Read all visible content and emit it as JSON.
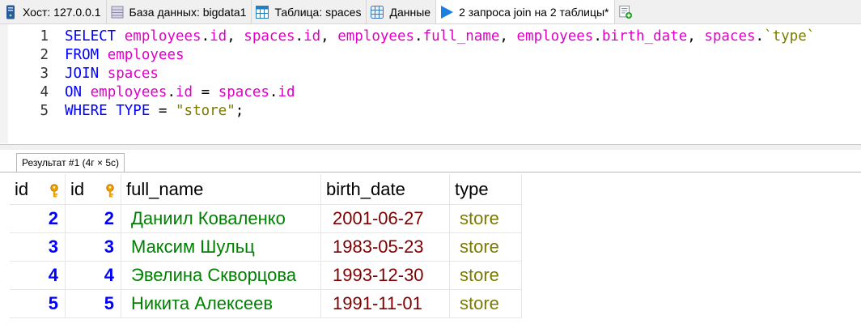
{
  "tabs": [
    {
      "label": "Хост: 127.0.0.1",
      "icon": "server-icon"
    },
    {
      "label": "База данных: bigdata1",
      "icon": "database-icon"
    },
    {
      "label": "Таблица: spaces",
      "icon": "table-icon"
    },
    {
      "label": "Данные",
      "icon": "grid-icon"
    },
    {
      "label": "2 запроса join на 2 таблицы*",
      "icon": "play-icon"
    },
    {
      "label": "",
      "icon": "new-query-icon"
    }
  ],
  "editor": {
    "line_numbers": [
      "1",
      "2",
      "3",
      "4",
      "5"
    ],
    "lines": [
      [
        {
          "t": "SELECT",
          "c": "kw"
        },
        {
          "t": " ",
          "c": "tx"
        },
        {
          "t": "employees",
          "c": "id"
        },
        {
          "t": ".",
          "c": "tx"
        },
        {
          "t": "id",
          "c": "id"
        },
        {
          "t": ", ",
          "c": "tx"
        },
        {
          "t": "spaces",
          "c": "id"
        },
        {
          "t": ".",
          "c": "tx"
        },
        {
          "t": "id",
          "c": "id"
        },
        {
          "t": ", ",
          "c": "tx"
        },
        {
          "t": "employees",
          "c": "id"
        },
        {
          "t": ".",
          "c": "tx"
        },
        {
          "t": "full_name",
          "c": "id"
        },
        {
          "t": ", ",
          "c": "tx"
        },
        {
          "t": "employees",
          "c": "id"
        },
        {
          "t": ".",
          "c": "tx"
        },
        {
          "t": "birth_date",
          "c": "id"
        },
        {
          "t": ", ",
          "c": "tx"
        },
        {
          "t": "spaces",
          "c": "id"
        },
        {
          "t": ".",
          "c": "tx"
        },
        {
          "t": "`type`",
          "c": "str"
        }
      ],
      [
        {
          "t": "FROM",
          "c": "kw"
        },
        {
          "t": " ",
          "c": "tx"
        },
        {
          "t": "employees",
          "c": "id"
        }
      ],
      [
        {
          "t": "JOIN",
          "c": "kw"
        },
        {
          "t": " ",
          "c": "tx"
        },
        {
          "t": "spaces",
          "c": "id"
        }
      ],
      [
        {
          "t": "ON",
          "c": "kw"
        },
        {
          "t": " ",
          "c": "tx"
        },
        {
          "t": "employees",
          "c": "id"
        },
        {
          "t": ".",
          "c": "tx"
        },
        {
          "t": "id",
          "c": "id"
        },
        {
          "t": " = ",
          "c": "tx"
        },
        {
          "t": "spaces",
          "c": "id"
        },
        {
          "t": ".",
          "c": "tx"
        },
        {
          "t": "id",
          "c": "id"
        }
      ],
      [
        {
          "t": "WHERE",
          "c": "kw"
        },
        {
          "t": " ",
          "c": "tx"
        },
        {
          "t": "TYPE",
          "c": "kw"
        },
        {
          "t": " = ",
          "c": "tx"
        },
        {
          "t": "\"store\"",
          "c": "str"
        },
        {
          "t": ";",
          "c": "tx"
        }
      ]
    ]
  },
  "result": {
    "tab_label": "Результат #1 (4г × 5с)",
    "columns": [
      {
        "label": "id",
        "key_icon": true
      },
      {
        "label": "id",
        "key_icon": true
      },
      {
        "label": "full_name",
        "key_icon": false
      },
      {
        "label": "birth_date",
        "key_icon": false
      },
      {
        "label": "type",
        "key_icon": false
      }
    ],
    "rows": [
      [
        "2",
        "2",
        "Даниил Коваленко",
        "2001-06-27",
        "store"
      ],
      [
        "3",
        "3",
        "Максим Шульц",
        "1983-05-23",
        "store"
      ],
      [
        "4",
        "4",
        "Эвелина Скворцова",
        "1993-12-30",
        "store"
      ],
      [
        "5",
        "5",
        "Никита Алексеев",
        "1991-11-01",
        "store"
      ]
    ]
  },
  "colors": {
    "keyword": "#0000ff",
    "identifier": "#e000c8",
    "string": "#7b7b00",
    "number": "#0000ff",
    "text_value": "#008000",
    "date_value": "#800000",
    "key_icon": "#f0a000"
  }
}
